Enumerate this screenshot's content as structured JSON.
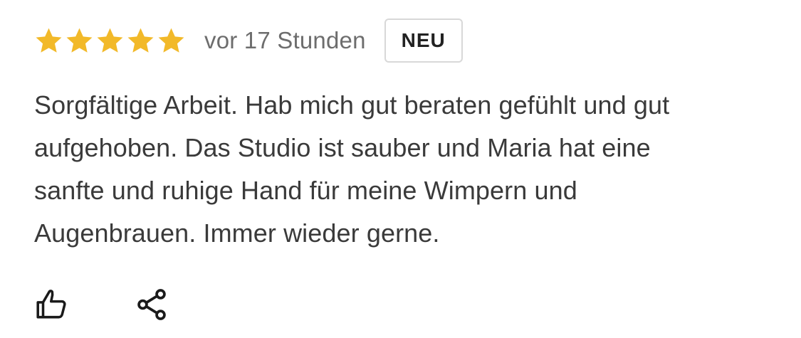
{
  "review": {
    "rating": 5,
    "rating_max": 5,
    "star_color": "#f2b929",
    "time_ago": "vor 17 Stunden",
    "badge": "NEU",
    "text": "Sorgfältige Arbeit. Hab mich gut beraten gefühlt und gut aufgehoben. Das Studio ist sauber und Maria hat eine sanfte und ruhige Hand für meine Wimpern und Augenbrauen. Immer wieder gerne."
  },
  "actions": {
    "like_icon": "thumbs-up-icon",
    "share_icon": "share-icon"
  }
}
